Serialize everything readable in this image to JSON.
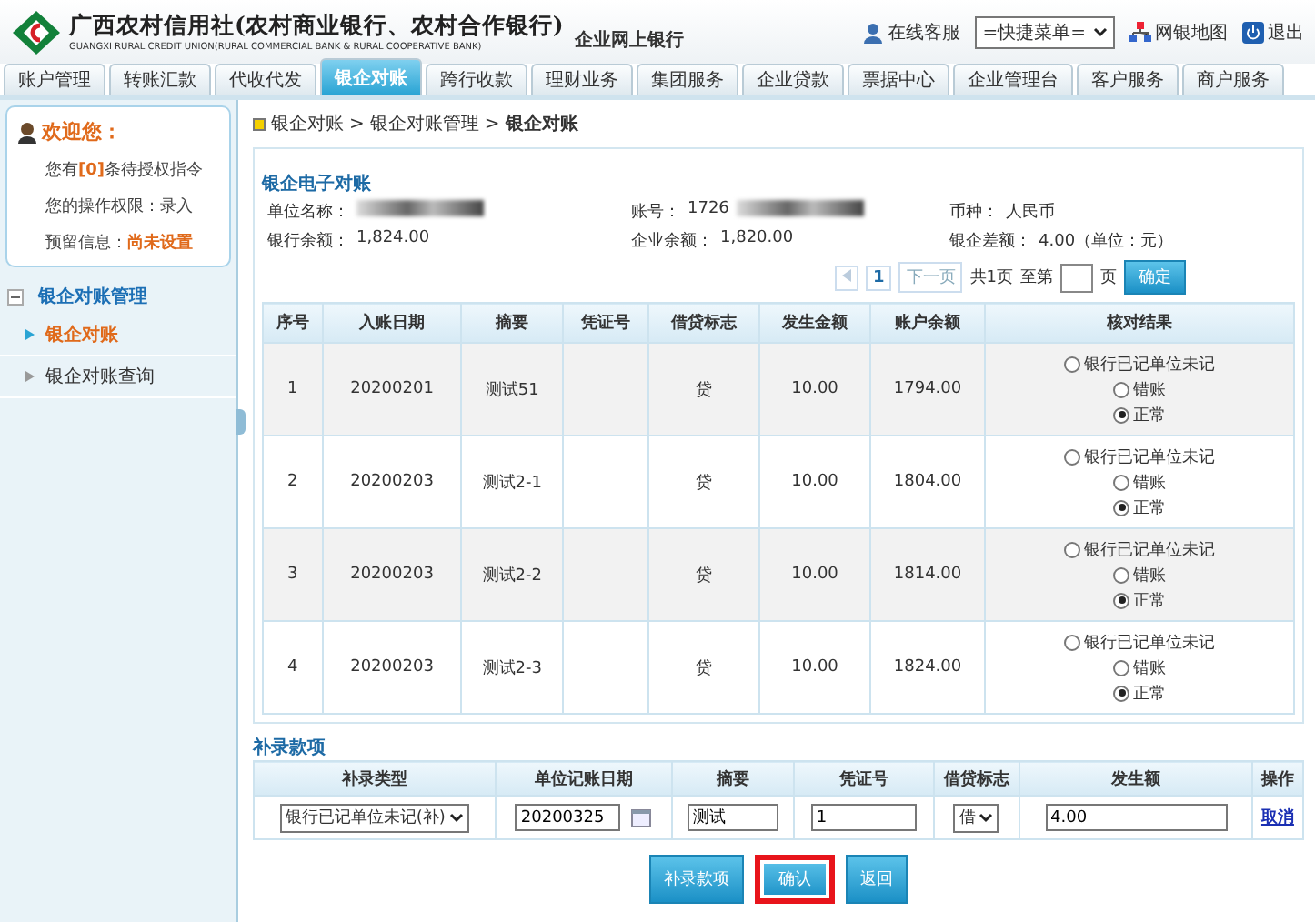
{
  "header": {
    "bank_name": "广西农村信用社(农村商业银行、农村合作银行)",
    "bank_name_en": "GUANGXI RURAL CREDIT UNION(RURAL COMMERCIAL BANK & RURAL COOPERATIVE BANK)",
    "product": "企业网上银行",
    "links": [
      {
        "kind": "service",
        "label": "在线客服"
      },
      {
        "kind": "select",
        "label": "=快捷菜单="
      },
      {
        "kind": "sitemap",
        "label": "网银地图"
      },
      {
        "kind": "logout",
        "label": "退出"
      }
    ]
  },
  "tabs": [
    {
      "label": "账户管理",
      "selected": false
    },
    {
      "label": "转账汇款",
      "selected": false
    },
    {
      "label": "代收代发",
      "selected": false
    },
    {
      "label": "银企对账",
      "selected": true
    },
    {
      "label": "跨行收款",
      "selected": false
    },
    {
      "label": "理财业务",
      "selected": false
    },
    {
      "label": "集团服务",
      "selected": false
    },
    {
      "label": "企业贷款",
      "selected": false
    },
    {
      "label": "票据中心",
      "selected": false
    },
    {
      "label": "企业管理台",
      "selected": false
    },
    {
      "label": "客户服务",
      "selected": false
    },
    {
      "label": "商户服务",
      "selected": false
    }
  ],
  "welcome": {
    "title": "欢迎您：",
    "pending": "您有**[0]**条待授权指令",
    "permission": "您的操作权限：录入",
    "reserved_label": "预留信息：",
    "reserved_value": "尚未设置"
  },
  "sidebar": {
    "group": "银企对账管理",
    "expanded": true,
    "items": [
      {
        "label": "银企对账",
        "selected": true
      },
      {
        "label": "银企对账查询",
        "selected": false
      }
    ]
  },
  "breadcrumb": [
    {
      "kind": "link",
      "label": "银企对账"
    },
    {
      "kind": "separator",
      "label": ">"
    },
    {
      "kind": "link",
      "label": "银企对账管理"
    },
    {
      "kind": "separator",
      "label": ">"
    },
    {
      "kind": "current",
      "label": "银企对账"
    }
  ],
  "section_title": "银企电子对账",
  "info": [
    {
      "label": "单位名称：",
      "redacted": true
    },
    {
      "label": "账号：",
      "value": "1726",
      "redacted": true
    },
    {
      "label": "币种：",
      "value": "人民币"
    },
    {
      "label": "银行余额：",
      "value": "1,824.00"
    },
    {
      "label": "企业余额：",
      "value": "1,820.00"
    },
    {
      "label": "银企差额：",
      "value": "4.00（单位：元）"
    }
  ],
  "pager": {
    "current": "1",
    "next": "下一页",
    "total": "共1页",
    "goto": "至第",
    "page_unit": "页",
    "confirm": "确定"
  },
  "table": {
    "columns": [
      "序号",
      "入账日期",
      "摘要",
      "凭证号",
      "借贷标志",
      "发生金额",
      "账户余额",
      "核对结果"
    ],
    "rows": [
      {
        "cells": [
          "1",
          "20200201",
          "测试51",
          "",
          "贷",
          "10.00",
          "1794.00"
        ],
        "options": [
          {
            "label": "银行已记单位未记",
            "selected": false
          },
          {
            "label": "错账",
            "selected": false
          },
          {
            "label": "正常",
            "selected": true
          }
        ]
      },
      {
        "cells": [
          "2",
          "20200203",
          "测试2-1",
          "",
          "贷",
          "10.00",
          "1804.00"
        ],
        "options": [
          {
            "label": "银行已记单位未记",
            "selected": false
          },
          {
            "label": "错账",
            "selected": false
          },
          {
            "label": "正常",
            "selected": true
          }
        ]
      },
      {
        "cells": [
          "3",
          "20200203",
          "测试2-2",
          "",
          "贷",
          "10.00",
          "1814.00"
        ],
        "options": [
          {
            "label": "银行已记单位未记",
            "selected": false
          },
          {
            "label": "错账",
            "selected": false
          },
          {
            "label": "正常",
            "selected": true
          }
        ]
      },
      {
        "cells": [
          "4",
          "20200203",
          "测试2-3",
          "",
          "贷",
          "10.00",
          "1824.00"
        ],
        "options": [
          {
            "label": "银行已记单位未记",
            "selected": false
          },
          {
            "label": "错账",
            "selected": false
          },
          {
            "label": "正常",
            "selected": true
          }
        ]
      }
    ]
  },
  "supplement": {
    "title": "补录款项",
    "columns": [
      "补录类型",
      "单位记账日期",
      "摘要",
      "凭证号",
      "借贷标志",
      "发生额",
      "操作"
    ],
    "row": {
      "type": "银行已记单位未记(补)",
      "date": "20200325",
      "summary": "测试",
      "voucher": "1",
      "direction": "借",
      "amount": "4.00",
      "action": "取消"
    }
  },
  "buttons": [
    {
      "label": "补录款项",
      "highlighted": false
    },
    {
      "label": "确认",
      "highlighted": true
    },
    {
      "label": "返回",
      "highlighted": false
    }
  ]
}
